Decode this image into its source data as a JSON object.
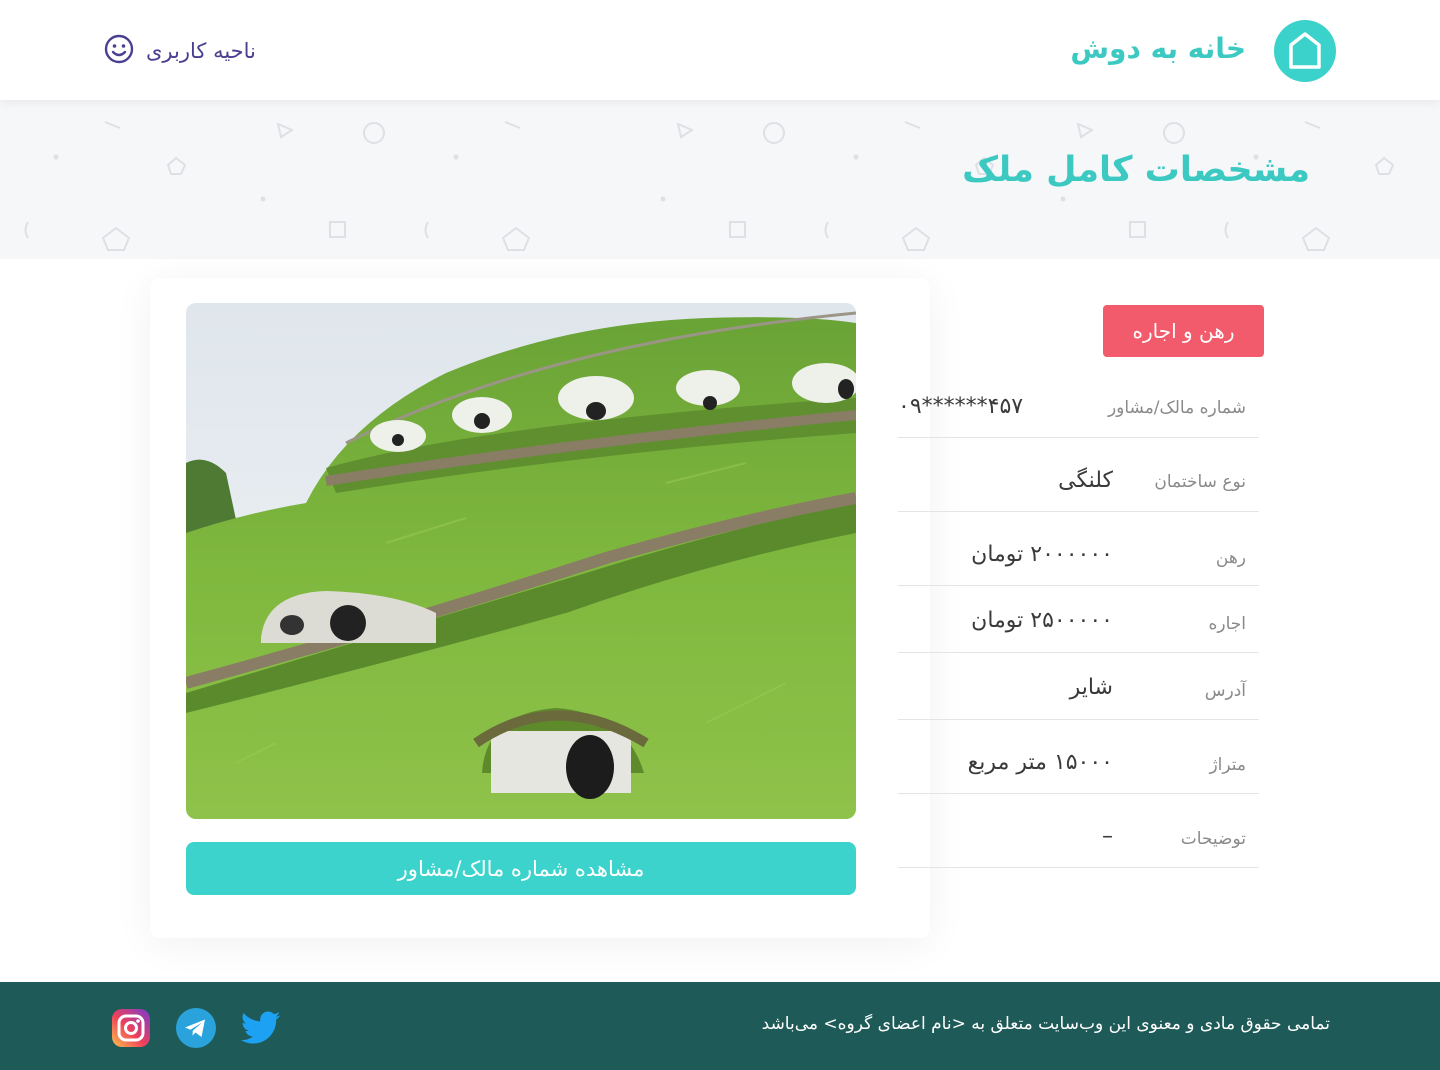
{
  "header": {
    "brand": "خانه به دوش",
    "user_area_label": "ناحیه کاربری"
  },
  "banner": {
    "title": "مشخصات کامل ملک"
  },
  "property": {
    "deal_type": "رهن و اجاره",
    "show_contact_button": "مشاهده شماره مالک/مشاور",
    "details": [
      {
        "label": "شماره مالک/مشاور",
        "value": "۰۹******۴۵۷"
      },
      {
        "label": "نوع ساختمان",
        "value": "کلنگی"
      },
      {
        "label": "رهن",
        "value": "۲۰۰۰۰۰۰ تومان"
      },
      {
        "label": "اجاره",
        "value": "۲۵۰۰۰۰۰ تومان"
      },
      {
        "label": "آدرس",
        "value": "شایر"
      },
      {
        "label": "متراژ",
        "value": "۱۵۰۰۰ متر مربع"
      },
      {
        "label": "توضیحات",
        "value": "–"
      }
    ]
  },
  "footer": {
    "copyright": "تمامی حقوق مادی و معنوی این وب‌سایت متعلق به <نام اعضای گروه> می‌باشد"
  },
  "colors": {
    "accent": "#3cd2cc",
    "badge": "#f25b6b",
    "footer_bg": "#1e5a57",
    "user_purple": "#4a4090"
  },
  "icons": [
    "house-logo-icon",
    "smiley-user-icon",
    "twitter-icon",
    "telegram-icon",
    "instagram-icon"
  ]
}
